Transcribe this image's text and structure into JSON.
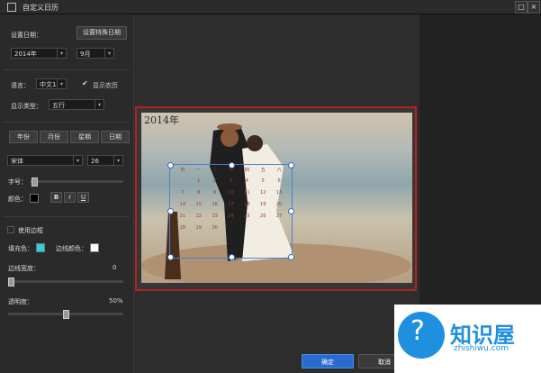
{
  "window": {
    "title": "自定义日历",
    "restore_glyph": "□",
    "close_glyph": "×"
  },
  "panel": {
    "set_date_label": "设置日期：",
    "special_date_button": "设置特殊日期",
    "year_select": "2014年",
    "month_select": "9月",
    "language_label": "语言：",
    "language_select": "中文1",
    "show_lunar_label": "显示农历",
    "show_lunar_checked": true,
    "display_type_label": "显示类型：",
    "display_type_select": "五行",
    "tabs": [
      "年份",
      "月份",
      "星期",
      "日期"
    ],
    "font_select": "宋体",
    "font_size_select": "26",
    "font_size_label": "字号：",
    "color_label": "颜色：",
    "text_color": "#000000",
    "bold_label": "B",
    "italic_label": "I",
    "underline_label": "U",
    "use_border_label": "使用边框",
    "fill_color_label": "填充色：",
    "fill_color": "#2fd0e0",
    "border_color_label": "边线颜色：",
    "border_color": "#ffffff",
    "border_width_label": "边线宽度：",
    "border_width_value": "0",
    "opacity_label": "透明度：",
    "opacity_value": "50%",
    "opacity_fraction": 0.5
  },
  "canvas": {
    "year_text": "2014年",
    "calendar_cells": [
      "日",
      "一",
      "二",
      "三",
      "四",
      "五",
      "六",
      "",
      "1",
      "2",
      "3",
      "4",
      "5",
      "6",
      "7",
      "8",
      "9",
      "10",
      "11",
      "12",
      "13",
      "14",
      "15",
      "16",
      "17",
      "18",
      "19",
      "20",
      "21",
      "22",
      "23",
      "24",
      "25",
      "26",
      "27",
      "28",
      "29",
      "30",
      "",
      "",
      "",
      ""
    ]
  },
  "footer": {
    "ok_button": "确定",
    "cancel_button": "取消"
  },
  "watermark": {
    "brand": "知识屋",
    "domain": "zhishiwu.com"
  }
}
